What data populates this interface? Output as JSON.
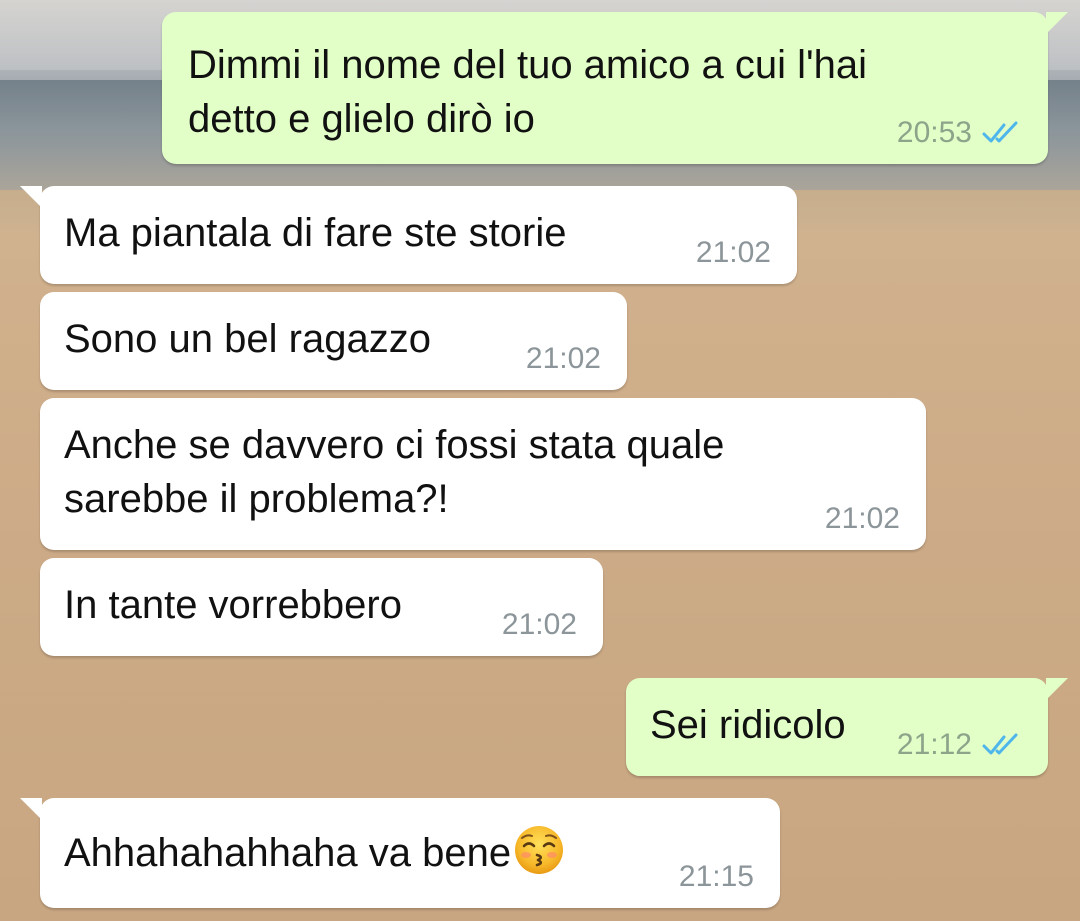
{
  "colors": {
    "incoming_bubble": "#ffffff",
    "outgoing_bubble": "#e2ffc7",
    "timestamp": "#8c9599",
    "read_ticks": "#4fb6ec"
  },
  "messages": [
    {
      "direction": "outgoing",
      "text": "Dimmi il nome del tuo amico a cui l'hai\ndetto e glielo dirò io",
      "time": "20:53",
      "status_icon": "double-check-read-icon"
    },
    {
      "direction": "incoming",
      "text": "Ma piantala di fare ste storie",
      "time": "21:02"
    },
    {
      "direction": "incoming",
      "text": "Sono un bel ragazzo",
      "time": "21:02"
    },
    {
      "direction": "incoming",
      "text": "Anche se davvero ci fossi stata quale\nsarebbe il problema?!",
      "time": "21:02"
    },
    {
      "direction": "incoming",
      "text": "In tante vorrebbero",
      "time": "21:02"
    },
    {
      "direction": "outgoing",
      "text": "Sei ridicolo",
      "time": "21:12",
      "status_icon": "double-check-read-icon"
    },
    {
      "direction": "incoming",
      "text": "Ahhahahahhaha va bene",
      "time": "21:15",
      "emoji": "kissing-face-with-closed-eyes-icon"
    }
  ]
}
